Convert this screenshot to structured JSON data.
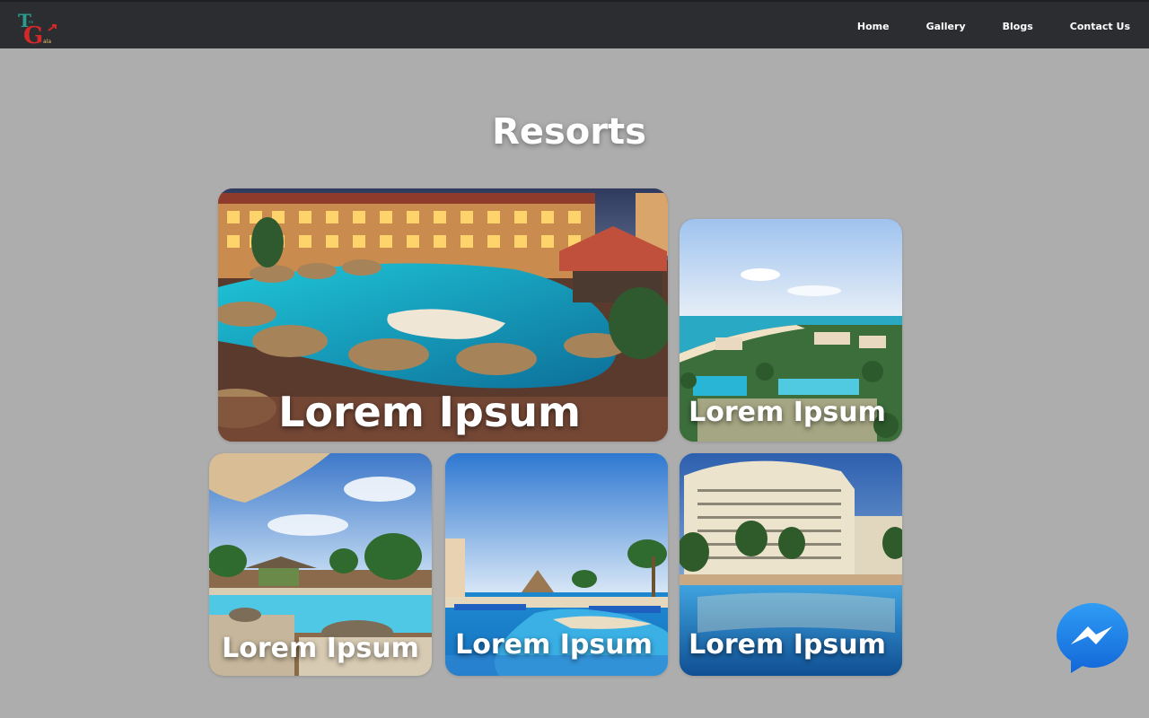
{
  "header": {
    "logo_text": "TG",
    "nav": [
      "Home",
      "Gallery",
      "Blogs",
      "Contact Us"
    ]
  },
  "main": {
    "title": "Resorts",
    "cards": [
      {
        "caption": "Lorem Ipsum",
        "scene": "night-resort-pool"
      },
      {
        "caption": "Lorem Ipsum",
        "scene": "beach-resort-aerial"
      },
      {
        "caption": "Lorem Ipsum",
        "scene": "pool-with-umbrella"
      },
      {
        "caption": "Lorem Ipsum",
        "scene": "blue-pool-palms"
      },
      {
        "caption": "Lorem Ipsum",
        "scene": "hotel-pool-reflection"
      }
    ]
  },
  "widgets": {
    "chat_icon": "messenger-icon",
    "accent": "#1e88e5"
  }
}
